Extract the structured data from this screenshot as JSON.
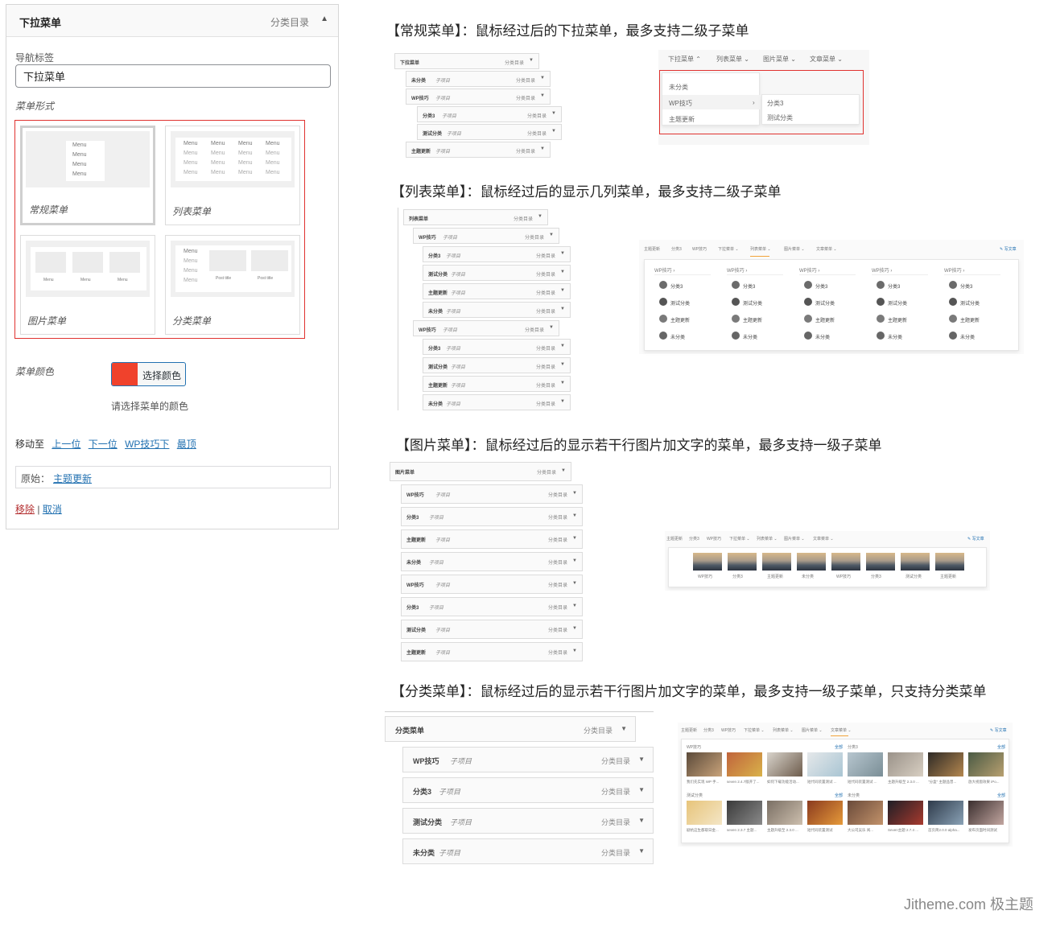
{
  "panel": {
    "title": "下拉菜单",
    "type": "分类目录",
    "toggle": "▲",
    "nav_label": "导航标签",
    "nav_value": "下拉菜单",
    "style_label": "菜单形式",
    "styles": [
      "常规菜单",
      "列表菜单",
      "图片菜单",
      "分类菜单"
    ],
    "mini_menu": "Menu",
    "mini_post": "Post title",
    "color_label": "菜单颜色",
    "color_value": "#f0422c",
    "color_button": "选择颜色",
    "color_hint": "请选择菜单的颜色",
    "move_label": "移动至",
    "move_links": [
      "上一位",
      "下一位",
      "WP技巧下",
      "最顶"
    ],
    "original_label": "原始：",
    "original_link": "主题更新",
    "remove": "移除",
    "sep": "|",
    "cancel": "取消"
  },
  "sections": [
    {
      "heading": "【常规菜单】：鼠标经过后的下拉菜单，最多支持二级子菜单"
    },
    {
      "heading": "【列表菜单】：鼠标经过后的显示几列菜单，最多支持二级子菜单"
    },
    {
      "heading": "【图片菜单】：鼠标经过后的显示若干行图片加文字的菜单，最多支持一级子菜单"
    },
    {
      "heading": "【分类菜单】：鼠标经过后的显示若干行图片加文字的菜单，最多支持一级子菜单，只支持分类菜单"
    }
  ],
  "labels": {
    "sub": "子项目",
    "cat": "分类目录",
    "arrow": "▼"
  },
  "sec1": {
    "rows": [
      "下拉菜单",
      "未分类",
      "WP技巧",
      "分类3",
      "测试分类",
      "主题更新"
    ],
    "nav": [
      "下拉菜单 ⌃",
      "列表菜单 ⌄",
      "图片菜单 ⌄",
      "文章菜单 ⌄"
    ],
    "drop": [
      "未分类",
      "WP技巧",
      "主题更新"
    ],
    "sub": [
      "分类3",
      "测试分类"
    ]
  },
  "sec2": {
    "rows": [
      "列表菜单",
      "WP技巧",
      "分类3",
      "测试分类",
      "主题更新",
      "未分类",
      "WP技巧",
      "分类3",
      "测试分类",
      "主题更新",
      "未分类"
    ],
    "nav": [
      "主题更新",
      "分类3",
      "WP技巧",
      "下拉菜单 ⌄",
      "列表菜单 ⌄",
      "图片菜单 ⌄",
      "文章菜单 ⌄"
    ],
    "post": "✎ 写文章",
    "col_head": "WP技巧 ›",
    "items": [
      "分类3",
      "测试分类",
      "主题更新",
      "未分类"
    ]
  },
  "sec3": {
    "rows": [
      "图片菜单",
      "WP技巧",
      "分类3",
      "主题更新",
      "未分类",
      "WP技巧",
      "分类3",
      "测试分类",
      "主题更新"
    ],
    "nav": [
      "主题更新",
      "分类3",
      "WP技巧",
      "下拉菜单 ⌄",
      "列表菜单 ⌄",
      "图片菜单 ⌄",
      "文章菜单 ⌄"
    ],
    "post": "✎ 写文章",
    "captions": [
      "WP技巧",
      "分类3",
      "主题更新",
      "未分类",
      "WP技巧",
      "分类3",
      "测试分类",
      "主题更新"
    ]
  },
  "sec4": {
    "rows": [
      "分类菜单",
      "WP技巧",
      "分类3",
      "测试分类",
      "未分类"
    ],
    "nav": [
      "主题更新",
      "分类3",
      "WP技巧",
      "下拉菜单 ⌄",
      "列表菜单 ⌄",
      "图片菜单 ⌄",
      "文章菜单 ⌄"
    ],
    "post": "✎ 写文章",
    "groups": [
      "WP技巧",
      "分类3",
      "测试分类",
      "未分类"
    ],
    "all": "全部",
    "cap_row1": [
      "我们先实现 WP 手...",
      "seven 2.4.7版开了...",
      "如何下载功能活动...",
      "短代码装置测试 ...",
      "短代码装置测试 ...",
      "主题升级至 2.3.0 ...",
      "\"分盒\" 主题品曾...",
      "放大视窗效果 iPo..."
    ],
    "cap_row2": [
      "剧抗这生都取日金...",
      "seven 2.3.7 主题...",
      "主题升级至 2.3.0 ...",
      "短代码装置测试",
      "大公司吴乐 阅...",
      "Seven主题 2.7.4 ...",
      "首页简2.0.0 alpha...",
      "发布页面时间测试"
    ]
  },
  "watermark": "Jitheme.com 极主题"
}
